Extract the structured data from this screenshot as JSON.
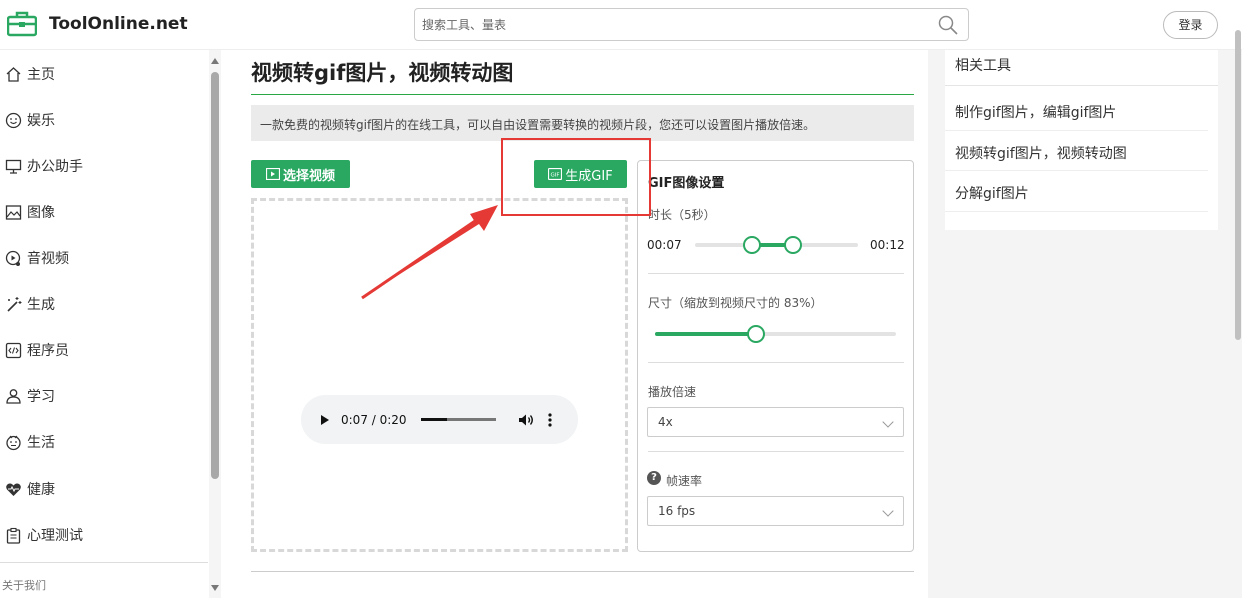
{
  "brand": {
    "name": "ToolOnline.net",
    "accent": "#2aa862"
  },
  "search": {
    "placeholder": "搜索工具、量表"
  },
  "header": {
    "login_label": "登录"
  },
  "sidebar": {
    "items": [
      {
        "label": "主页",
        "icon": "home-icon"
      },
      {
        "label": "娱乐",
        "icon": "smile-icon"
      },
      {
        "label": "办公助手",
        "icon": "monitor-icon"
      },
      {
        "label": "图像",
        "icon": "image-icon"
      },
      {
        "label": "音视频",
        "icon": "audio-video-icon"
      },
      {
        "label": "生成",
        "icon": "magic-wand-icon"
      },
      {
        "label": "程序员",
        "icon": "code-icon"
      },
      {
        "label": "学习",
        "icon": "study-icon"
      },
      {
        "label": "生活",
        "icon": "life-icon"
      },
      {
        "label": "健康",
        "icon": "heart-icon"
      },
      {
        "label": "心理测试",
        "icon": "clipboard-icon"
      }
    ],
    "about": "关于我们"
  },
  "main": {
    "title": "视频转gif图片，视频转动图",
    "description": "一款免费的视频转gif图片的在线工具，可以自由设置需要转换的视频片段，您还可以设置图片播放倍速。",
    "select_video_label": "选择视频",
    "generate_gif_label": "生成GIF",
    "player": {
      "time": "0:07 / 0:20",
      "progress": 0.35
    }
  },
  "settings": {
    "title": "GIF图像设置",
    "duration_label": "时长（5秒）",
    "start_time": "00:07",
    "end_time": "00:12",
    "range_start_fraction": 0.35,
    "range_end_fraction": 0.6,
    "size_label": "尺寸（缩放到视频尺寸的 83%）",
    "size_fraction": 0.42,
    "speed_label": "播放倍速",
    "speed_value": "4x",
    "fps_label": "帧速率",
    "fps_value": "16 fps"
  },
  "related": {
    "title": "相关工具",
    "items": [
      "制作gif图片，编辑gif图片",
      "视频转gif图片，视频转动图",
      "分解gif图片"
    ]
  }
}
